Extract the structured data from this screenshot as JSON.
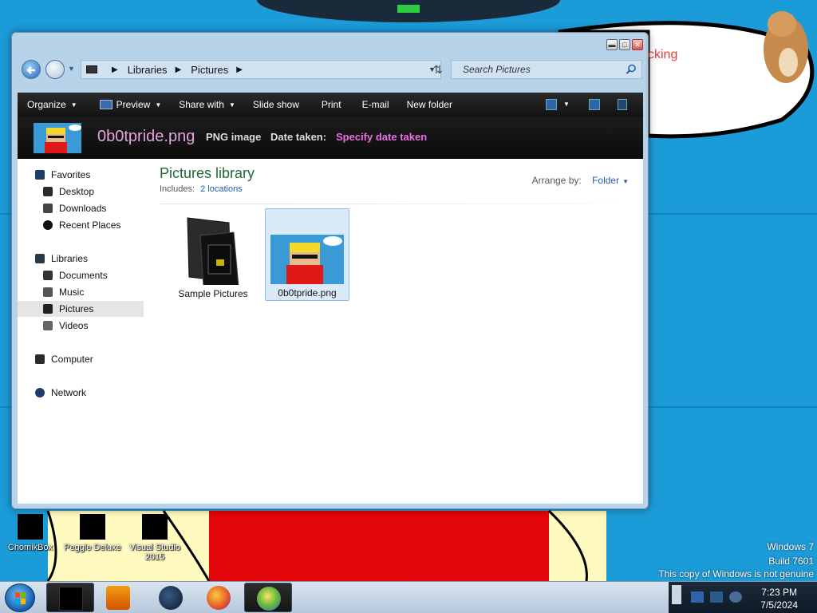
{
  "window": {
    "address": {
      "crumbs": [
        "Libraries",
        "Pictures"
      ]
    },
    "search_placeholder": "Search Pictures",
    "toolbar": {
      "organize": "Organize",
      "preview": "Preview",
      "share_with": "Share with",
      "slide_show": "Slide show",
      "print": "Print",
      "email": "E-mail",
      "new_folder": "New folder"
    },
    "details": {
      "filename": "0b0tpride.png",
      "filetype": "PNG image",
      "date_label": "Date taken:",
      "date_value": "Specify date taken"
    },
    "nav": {
      "favorites": "Favorites",
      "desktop": "Desktop",
      "downloads": "Downloads",
      "recent_places": "Recent Places",
      "libraries": "Libraries",
      "documents": "Documents",
      "music": "Music",
      "pictures": "Pictures",
      "videos": "Videos",
      "computer": "Computer",
      "network": "Network"
    },
    "library": {
      "title": "Pictures library",
      "includes_label": "Includes:",
      "includes_link": "2 locations",
      "arrange_label": "Arrange by:",
      "arrange_value": "Folder"
    },
    "items": [
      {
        "label": "Sample Pictures",
        "type": "folder",
        "selected": false
      },
      {
        "label": "0b0tpride.png",
        "type": "image",
        "selected": true
      }
    ]
  },
  "desktop": {
    "speech_text": "cking",
    "icons": [
      "ChomikBox",
      "Peggle Deluxe",
      "Visual Studio 2015"
    ],
    "watermark": {
      "line1": "Windows 7",
      "line2": "Build 7601",
      "line3": "This copy of Windows is not genuine"
    }
  },
  "taskbar": {
    "time": "7:23 PM",
    "date": "7/5/2024",
    "pinned": [
      "explorer",
      "media-player",
      "globe",
      "firefox",
      "windows-explorer-active"
    ]
  },
  "colors": {
    "desktop_bg": "#1b9bd8",
    "library_title": "#1e6a32",
    "filename": "#e6a3e0",
    "date_value": "#ea6fe4",
    "link": "#1f5fa8"
  }
}
